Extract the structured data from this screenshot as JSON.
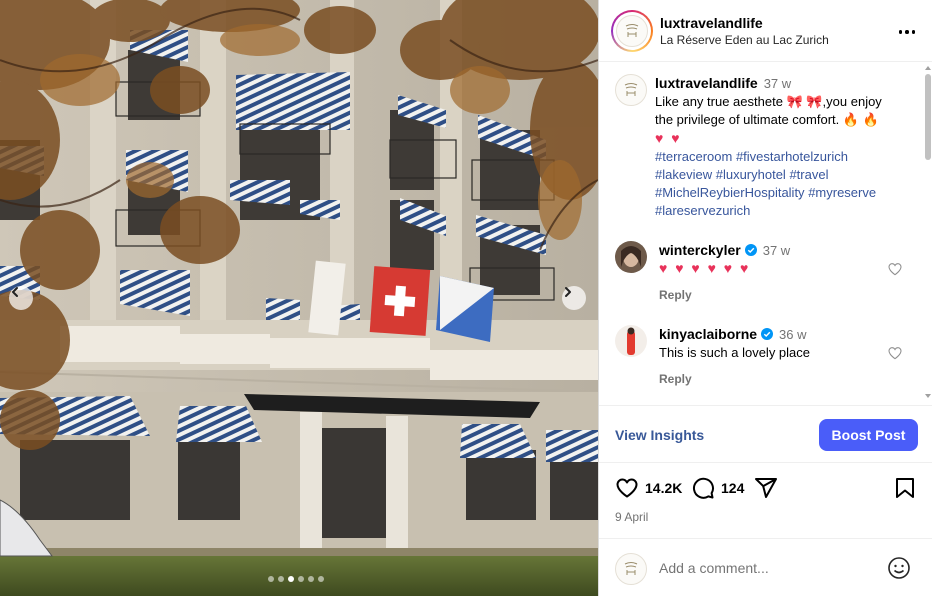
{
  "post": {
    "username": "luxtravelandlife",
    "location": "La Réserve Eden au Lac Zurich"
  },
  "caption": {
    "username": "luxtravelandlife",
    "time": "37 w",
    "text_line1": "Like any true aesthete",
    "text_mid": ",you enjoy",
    "text_line2": "the privilege of ultimate comfort.",
    "hashtags": [
      "#terraceroom",
      "#fivestarhotelzurich",
      "#lakeview",
      "#luxuryhotel",
      "#travel",
      "#MichelReybierHospitality",
      "#myreserve",
      "#lareservezurich"
    ]
  },
  "comments": [
    {
      "username": "winterckyler",
      "time": "37 w",
      "text": "",
      "emoji": "♥ ♥ ♥ ♥ ♥ ♥",
      "reply": "Reply"
    },
    {
      "username": "kinyaclaiborne",
      "time": "36 w",
      "text": "This is such a lovely place",
      "reply": "Reply"
    }
  ],
  "insights": {
    "view_label": "View Insights",
    "boost_label": "Boost Post"
  },
  "actions": {
    "likes": "14.2K",
    "comments": "124"
  },
  "date": "9 April",
  "add_comment": {
    "placeholder": "Add a comment..."
  },
  "carousel": {
    "slides": 6,
    "active": 2
  },
  "colors": {
    "accent": "#4a5df9",
    "link": "#385898",
    "verified": "#0095f6"
  },
  "icons": [
    "chevron-left-icon",
    "chevron-right-icon",
    "more-icon",
    "heart-icon",
    "comment-icon",
    "share-icon",
    "bookmark-icon",
    "emoji-icon",
    "verified-icon"
  ]
}
